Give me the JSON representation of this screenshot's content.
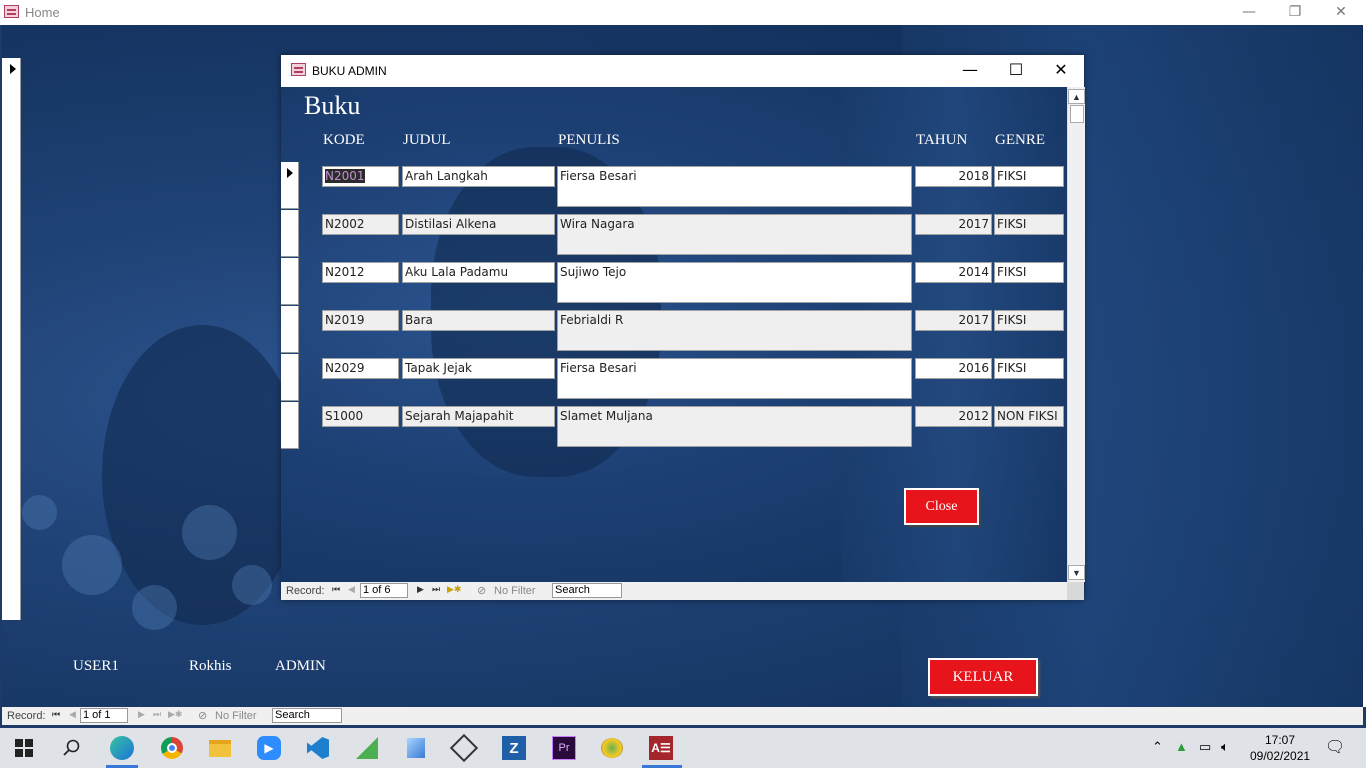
{
  "window": {
    "title": "Home"
  },
  "form_footer": {
    "user_id": "USER1",
    "user_name": "Rokhis",
    "user_role": "ADMIN",
    "exit_label": "KELUAR"
  },
  "main_nav": {
    "record_label": "Record:",
    "current": "1 of 1",
    "filter_label": "No Filter",
    "search_placeholder": "Search"
  },
  "popup": {
    "title": "BUKU ADMIN",
    "heading": "Buku",
    "columns": {
      "kode": "KODE",
      "judul": "JUDUL",
      "penulis": "PENULIS",
      "tahun": "TAHUN",
      "genre": "GENRE"
    },
    "rows": [
      {
        "kode": "N2001",
        "judul": "Arah Langkah",
        "penulis": "Fiersa Besari",
        "tahun": "2018",
        "genre": "FIKSI"
      },
      {
        "kode": "N2002",
        "judul": "Distilasi Alkena",
        "penulis": "Wira Nagara",
        "tahun": "2017",
        "genre": "FIKSI"
      },
      {
        "kode": "N2012",
        "judul": "Aku Lala Padamu",
        "penulis": "Sujiwo Tejo",
        "tahun": "2014",
        "genre": "FIKSI"
      },
      {
        "kode": "N2019",
        "judul": "Bara",
        "penulis": "Febrialdi R",
        "tahun": "2017",
        "genre": "FIKSI"
      },
      {
        "kode": "N2029",
        "judul": "Tapak Jejak",
        "penulis": "Fiersa Besari",
        "tahun": "2016",
        "genre": "FIKSI"
      },
      {
        "kode": "S1000",
        "judul": "Sejarah Majapahit",
        "penulis": "Slamet Muljana",
        "tahun": "2012",
        "genre": "NON FIKSI"
      }
    ],
    "close_label": "Close",
    "nav": {
      "record_label": "Record:",
      "current": "1 of 6",
      "filter_label": "No Filter",
      "search_placeholder": "Search"
    }
  },
  "taskbar": {
    "apps": [
      "windows-start",
      "search",
      "edge",
      "chrome",
      "file-explorer",
      "zoom",
      "vscode",
      "app-green",
      "box-3d",
      "virtualbox",
      "app-filezilla",
      "premiere",
      "app-paint",
      "access"
    ],
    "clock_time": "17:07",
    "clock_date": "09/02/2021"
  },
  "colors": {
    "accent_red": "#e8141c",
    "background_blue": "#1e3a66"
  }
}
